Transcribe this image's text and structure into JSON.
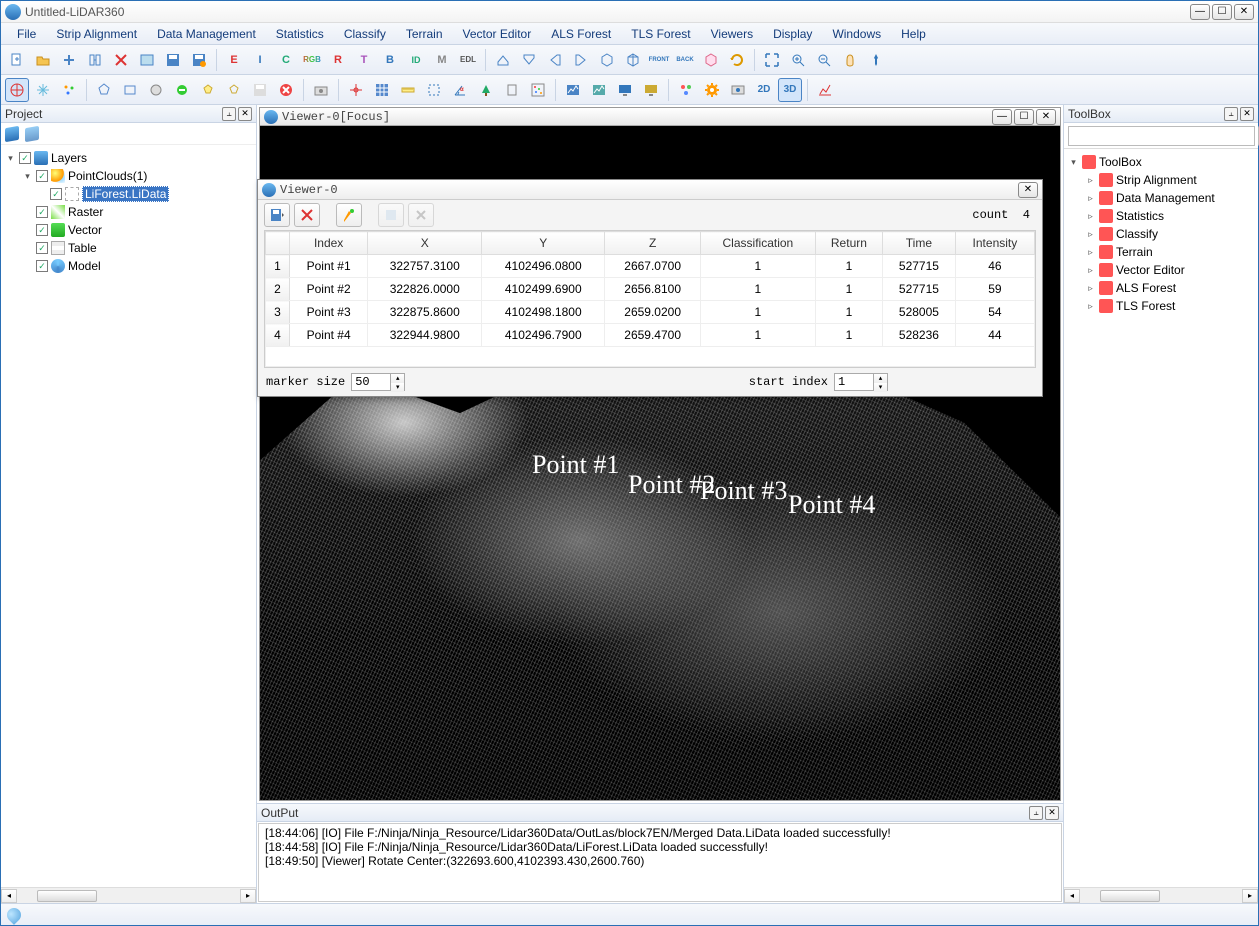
{
  "title": "Untitled-LiDAR360",
  "menus": [
    "File",
    "Strip Alignment",
    "Data Management",
    "Statistics",
    "Classify",
    "Terrain",
    "Vector Editor",
    "ALS Forest",
    "TLS Forest",
    "Viewers",
    "Display",
    "Windows",
    "Help"
  ],
  "project": {
    "title": "Project",
    "layers_label": "Layers",
    "pointclouds_label": "PointClouds(1)",
    "lidata_label": "LiForest.LiData",
    "raster_label": "Raster",
    "vector_label": "Vector",
    "table_label": "Table",
    "model_label": "Model"
  },
  "viewer": {
    "title": "Viewer-0[Focus]",
    "pt_labels": [
      "Point #1",
      "Point #2",
      "Point #3",
      "Point #4"
    ]
  },
  "dialog": {
    "title": "Viewer-0",
    "count_label": "count",
    "count_value": "4",
    "headers": [
      "Index",
      "X",
      "Y",
      "Z",
      "Classification",
      "Return",
      "Time",
      "Intensity"
    ],
    "rows": [
      {
        "n": "1",
        "index": "Point #1",
        "x": "322757.3100",
        "y": "4102496.0800",
        "z": "2667.0700",
        "cls": "1",
        "ret": "1",
        "time": "527715",
        "int": "46"
      },
      {
        "n": "2",
        "index": "Point #2",
        "x": "322826.0000",
        "y": "4102499.6900",
        "z": "2656.8100",
        "cls": "1",
        "ret": "1",
        "time": "527715",
        "int": "59"
      },
      {
        "n": "3",
        "index": "Point #3",
        "x": "322875.8600",
        "y": "4102498.1800",
        "z": "2659.0200",
        "cls": "1",
        "ret": "1",
        "time": "528005",
        "int": "54"
      },
      {
        "n": "4",
        "index": "Point #4",
        "x": "322944.9800",
        "y": "4102496.7900",
        "z": "2659.4700",
        "cls": "1",
        "ret": "1",
        "time": "528236",
        "int": "44"
      }
    ],
    "marker_label": "marker size",
    "marker_value": "50",
    "startidx_label": "start index",
    "startidx_value": "1"
  },
  "toolbox": {
    "title": "ToolBox",
    "root": "ToolBox",
    "items": [
      "Strip Alignment",
      "Data Management",
      "Statistics",
      "Classify",
      "Terrain",
      "Vector Editor",
      "ALS Forest",
      "TLS Forest"
    ]
  },
  "output": {
    "title": "OutPut",
    "lines": [
      "[18:44:06] [IO]     File F:/Ninja/Ninja_Resource/Lidar360Data/OutLas/block7EN/Merged Data.LiData loaded successfully!",
      "[18:44:58] [IO]     File F:/Ninja/Ninja_Resource/Lidar360Data/LiForest.LiData loaded successfully!",
      "[18:49:50] [Viewer]    Rotate Center:(322693.600,4102393.430,2600.760)"
    ]
  },
  "btn_2d": "2D",
  "btn_3d": "3D",
  "tb1_labels": {
    "e": "E",
    "i": "I",
    "c": "C",
    "rgb": "RGB",
    "r": "R",
    "t": "T",
    "b": "B",
    "id": "ID",
    "m": "M",
    "edl": "EDL",
    "front": "FRONT",
    "back": "BACK"
  }
}
